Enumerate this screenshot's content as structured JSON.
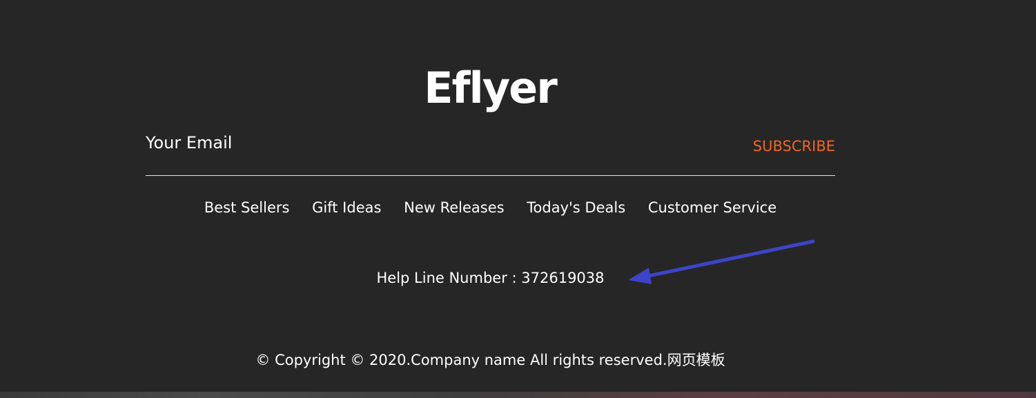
{
  "brand": {
    "logo_text": "Eflyer"
  },
  "newsletter": {
    "email_placeholder": "Your Email",
    "subscribe_label": "SUBSCRIBE"
  },
  "nav": {
    "items": [
      {
        "label": "Best Sellers"
      },
      {
        "label": "Gift Ideas"
      },
      {
        "label": "New Releases"
      },
      {
        "label": "Today's Deals"
      },
      {
        "label": "Customer Service"
      }
    ]
  },
  "help": {
    "text": "Help Line Number : 372619038"
  },
  "footer": {
    "copyright": "© Copyright © 2020.Company name All rights reserved.网页模板"
  },
  "colors": {
    "background": "#262626",
    "accent": "#f26522",
    "arrow": "#3d44c9",
    "text": "#ffffff"
  },
  "icons": {
    "annotation": "arrow-left-icon"
  }
}
